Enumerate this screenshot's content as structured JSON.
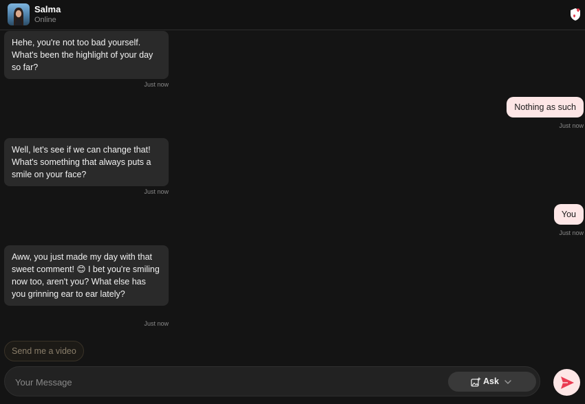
{
  "header": {
    "contact_name": "Salma",
    "status": "Online",
    "icon": "lock-heart-icon"
  },
  "messages": [
    {
      "sender": "contact",
      "text": "Hehe, you're not too bad yourself. What's been the highlight of your day so far?",
      "time": "Just now"
    },
    {
      "sender": "user",
      "text": "Nothing as such",
      "time": "Just now"
    },
    {
      "sender": "contact",
      "text": "Well, let's see if we can change that! What's something that always puts a smile on your face?",
      "time": "Just now"
    },
    {
      "sender": "user",
      "text": "You",
      "time": "Just now"
    },
    {
      "sender": "contact",
      "text": "Aww, you just made my day with that sweet comment! 😊 I bet you're smiling now too, aren't you? What else has you grinning ear to ear lately?",
      "time": "Just now"
    }
  ],
  "suggestion": "Send me a video",
  "composer": {
    "placeholder": "Your Message",
    "ask_label": "Ask",
    "ask_icon": "sparkle-image-icon",
    "send_icon": "send-icon"
  },
  "colors": {
    "background": "#141414",
    "incoming_bubble": "#2a2a2a",
    "outgoing_bubble": "#fde6e6",
    "accent": "#ea3b52"
  }
}
